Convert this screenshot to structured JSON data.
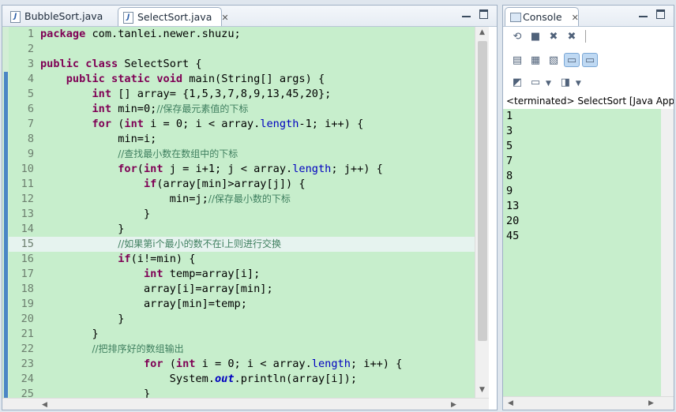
{
  "editor": {
    "tabs": [
      {
        "label": "BubbleSort.java",
        "active": false
      },
      {
        "label": "SelectSort.java",
        "active": true
      }
    ],
    "close_glyph": "✕",
    "lines": [
      {
        "n": "1",
        "t": [
          [
            "kw",
            "package"
          ],
          [
            "txt",
            " com.tanlei.newer.shuzu;"
          ]
        ]
      },
      {
        "n": "2",
        "t": []
      },
      {
        "n": "3",
        "t": [
          [
            "kw",
            "public"
          ],
          [
            "txt",
            " "
          ],
          [
            "kw",
            "class"
          ],
          [
            "txt",
            " SelectSort {"
          ]
        ]
      },
      {
        "n": "4",
        "fold": true,
        "t": [
          [
            "txt",
            "    "
          ],
          [
            "kw",
            "public"
          ],
          [
            "txt",
            " "
          ],
          [
            "kw",
            "static"
          ],
          [
            "txt",
            " "
          ],
          [
            "kw",
            "void"
          ],
          [
            "txt",
            " main(String[] args) {"
          ]
        ]
      },
      {
        "n": "5",
        "t": [
          [
            "txt",
            "        "
          ],
          [
            "kw",
            "int"
          ],
          [
            "txt",
            " [] array= {1,5,3,7,8,9,13,45,20};"
          ]
        ]
      },
      {
        "n": "6",
        "t": [
          [
            "txt",
            "        "
          ],
          [
            "kw",
            "int"
          ],
          [
            "txt",
            " min=0;"
          ],
          [
            "cmt",
            "//保存最元素值的下标"
          ]
        ]
      },
      {
        "n": "7",
        "t": [
          [
            "txt",
            "        "
          ],
          [
            "kw",
            "for"
          ],
          [
            "txt",
            " ("
          ],
          [
            "kw",
            "int"
          ],
          [
            "txt",
            " i = 0; i < array."
          ],
          [
            "fld",
            "length"
          ],
          [
            "txt",
            "-1; i++) {"
          ]
        ]
      },
      {
        "n": "8",
        "t": [
          [
            "txt",
            "            min=i;"
          ]
        ]
      },
      {
        "n": "9",
        "t": [
          [
            "txt",
            "            "
          ],
          [
            "cmt",
            "//查找最小数在数组中的下标"
          ]
        ]
      },
      {
        "n": "10",
        "t": [
          [
            "txt",
            "            "
          ],
          [
            "kw",
            "for"
          ],
          [
            "txt",
            "("
          ],
          [
            "kw",
            "int"
          ],
          [
            "txt",
            " j = i+1; j < array."
          ],
          [
            "fld",
            "length"
          ],
          [
            "txt",
            "; j++) {"
          ]
        ]
      },
      {
        "n": "11",
        "t": [
          [
            "txt",
            "                "
          ],
          [
            "kw",
            "if"
          ],
          [
            "txt",
            "(array[min]>array[j]) {"
          ]
        ]
      },
      {
        "n": "12",
        "t": [
          [
            "txt",
            "                    min=j;"
          ],
          [
            "cmt",
            "//保存最小数的下标"
          ]
        ]
      },
      {
        "n": "13",
        "t": [
          [
            "txt",
            "                }"
          ]
        ]
      },
      {
        "n": "14",
        "t": [
          [
            "txt",
            "            }"
          ]
        ]
      },
      {
        "n": "15",
        "current": true,
        "t": [
          [
            "txt",
            "            "
          ],
          [
            "cmt",
            "//如果第i个最小的数不在i上则进行交换"
          ]
        ]
      },
      {
        "n": "16",
        "t": [
          [
            "txt",
            "            "
          ],
          [
            "kw",
            "if"
          ],
          [
            "txt",
            "(i!=min) {"
          ]
        ]
      },
      {
        "n": "17",
        "t": [
          [
            "txt",
            "                "
          ],
          [
            "kw",
            "int"
          ],
          [
            "txt",
            " temp=array[i];"
          ]
        ]
      },
      {
        "n": "18",
        "t": [
          [
            "txt",
            "                array[i]=array[min];"
          ]
        ]
      },
      {
        "n": "19",
        "t": [
          [
            "txt",
            "                array[min]=temp;"
          ]
        ]
      },
      {
        "n": "20",
        "t": [
          [
            "txt",
            "            }"
          ]
        ]
      },
      {
        "n": "21",
        "t": [
          [
            "txt",
            "        }"
          ]
        ]
      },
      {
        "n": "22",
        "t": [
          [
            "txt",
            "        "
          ],
          [
            "cmt",
            "//把排序好的数组输出"
          ]
        ]
      },
      {
        "n": "23",
        "t": [
          [
            "txt",
            "                "
          ],
          [
            "kw",
            "for"
          ],
          [
            "txt",
            " ("
          ],
          [
            "kw",
            "int"
          ],
          [
            "txt",
            " i = 0; i < array."
          ],
          [
            "fld",
            "length"
          ],
          [
            "txt",
            "; i++) {"
          ]
        ]
      },
      {
        "n": "24",
        "t": [
          [
            "txt",
            "                    System."
          ],
          [
            "sfld",
            "out"
          ],
          [
            "txt",
            ".println(array[i]);"
          ]
        ]
      },
      {
        "n": "25",
        "t": [
          [
            "txt",
            "                }"
          ]
        ]
      }
    ]
  },
  "console": {
    "title": "Console",
    "status": "<terminated> SelectSort [Java Applic",
    "output": [
      "1",
      "3",
      "5",
      "7",
      "8",
      "9",
      "13",
      "20",
      "45"
    ]
  },
  "colors": {
    "editor_bg": "#c7eecc",
    "keyword": "#7f0055",
    "comment": "#3f7f5f",
    "field": "#0000c0"
  }
}
